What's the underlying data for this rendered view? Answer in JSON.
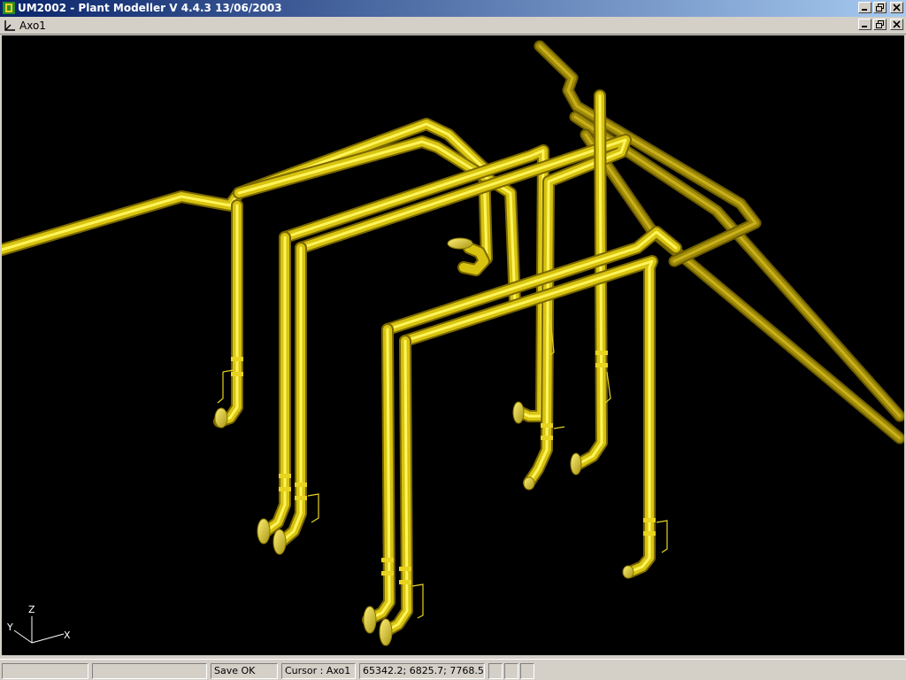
{
  "window": {
    "title": "UM2002 - Plant Modeller V 4.4.3 13/06/2003",
    "app_icon": "um2002-app-icon",
    "buttons": [
      "minimize-icon",
      "restore-icon",
      "close-icon"
    ]
  },
  "document": {
    "title": "Axo1",
    "icon": "axo-view-icon"
  },
  "viewport": {
    "background": "#000000",
    "pipe_color": "#f0e020",
    "axes": {
      "z": "Z",
      "y": "Y",
      "x": "X"
    }
  },
  "status": {
    "panes": [
      "",
      "",
      "Save OK",
      "Cursor : Axo1",
      "65342.2; 6825.7; 7768.5;",
      "",
      "",
      ""
    ]
  }
}
